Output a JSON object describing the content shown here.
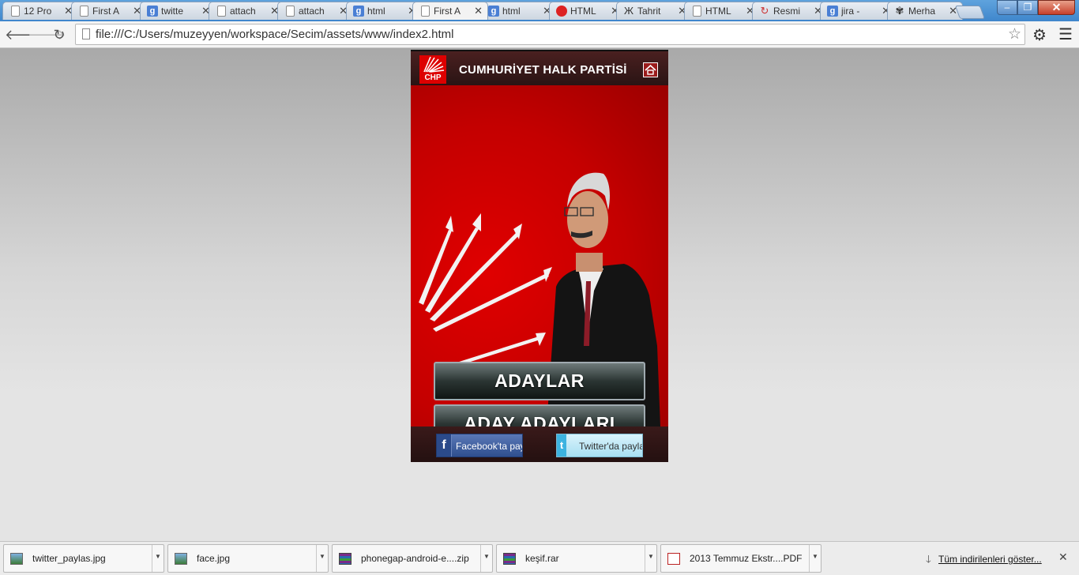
{
  "tabs": [
    {
      "label": "12 Pro",
      "icon": "page-icon"
    },
    {
      "label": "First A",
      "icon": "page-icon"
    },
    {
      "label": "twitte",
      "icon": "google-icon"
    },
    {
      "label": "attach",
      "icon": "page-icon"
    },
    {
      "label": "attach",
      "icon": "page-icon"
    },
    {
      "label": "html",
      "icon": "google-icon"
    },
    {
      "label": "First A",
      "icon": "page-icon",
      "active": true
    },
    {
      "label": "html",
      "icon": "google-icon"
    },
    {
      "label": "HTML",
      "icon": "red-circle-icon"
    },
    {
      "label": "Tahrit",
      "icon": "tower-icon"
    },
    {
      "label": "HTML",
      "icon": "page-icon"
    },
    {
      "label": "Resmi",
      "icon": "gc-icon"
    },
    {
      "label": "jira -",
      "icon": "google-icon"
    },
    {
      "label": "Merha",
      "icon": "bug-icon"
    }
  ],
  "window_controls": {
    "minimize": "–",
    "maximize": "❐",
    "close": "✕"
  },
  "toolbar": {
    "url": "file:///C:/Users/muzeyyen/workspace/Secim/assets/www/index2.html"
  },
  "app": {
    "logo_text": "CHP",
    "title": "CUMHURİYET HALK PARTİSİ",
    "buttons": [
      "ADAYLAR",
      "ADAY ADAYLARI"
    ],
    "share": {
      "facebook": {
        "logo": "f",
        "text": "Facebook'ta paylaş"
      },
      "twitter": {
        "logo": "t",
        "text": "Twitter'da paylaş"
      }
    },
    "colors": {
      "brand_red": "#c60000",
      "header_dark": "#3a1a1a"
    }
  },
  "downloads": {
    "items": [
      {
        "name": "twitter_paylas.jpg",
        "icon": "image-icon"
      },
      {
        "name": "face.jpg",
        "icon": "image-icon"
      },
      {
        "name": "phonegap-android-e....zip",
        "icon": "archive-icon"
      },
      {
        "name": "keşif.rar",
        "icon": "archive-icon"
      },
      {
        "name": "2013 Temmuz Ekstr....PDF",
        "icon": "pdf-icon"
      }
    ],
    "show_all": "Tüm indirilenleri göster..."
  }
}
